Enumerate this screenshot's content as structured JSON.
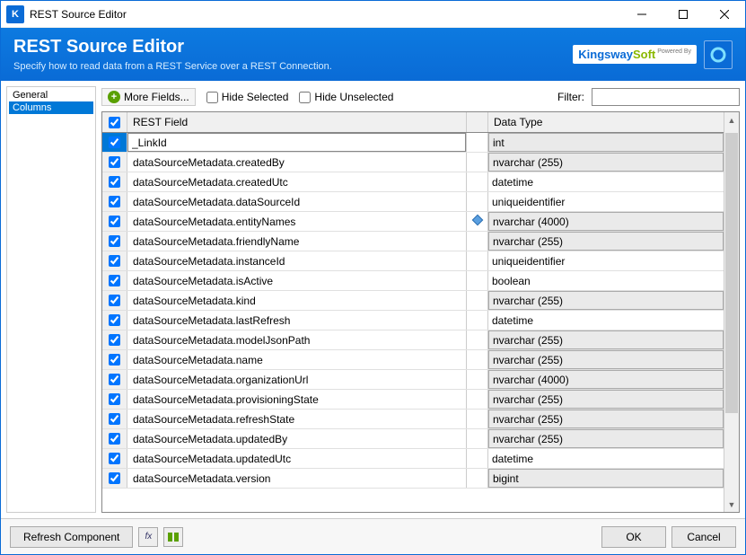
{
  "window": {
    "title": "REST Source Editor"
  },
  "header": {
    "title": "REST Source Editor",
    "subtitle": "Specify how to read data from a REST Service over a REST Connection.",
    "powered_by": "Powered By",
    "logo1": "Kingsway",
    "logo2": "Soft"
  },
  "sidebar": {
    "items": [
      "General",
      "Columns"
    ],
    "selected_index": 1
  },
  "toolbar": {
    "more_fields": "More Fields...",
    "hide_selected": "Hide Selected",
    "hide_unselected": "Hide Unselected",
    "filter_label": "Filter:",
    "filter_value": ""
  },
  "grid": {
    "headers": {
      "field": "REST Field",
      "type": "Data Type"
    },
    "rows": [
      {
        "checked": true,
        "field": "_LinkId",
        "type": "int",
        "selected": true,
        "has_icon": false,
        "dd": true
      },
      {
        "checked": true,
        "field": "dataSourceMetadata.createdBy",
        "type": "nvarchar (255)",
        "selected": false,
        "has_icon": false,
        "dd": true
      },
      {
        "checked": true,
        "field": "dataSourceMetadata.createdUtc",
        "type": "datetime",
        "selected": false,
        "has_icon": false,
        "dd": false
      },
      {
        "checked": true,
        "field": "dataSourceMetadata.dataSourceId",
        "type": "uniqueidentifier",
        "selected": false,
        "has_icon": false,
        "dd": false
      },
      {
        "checked": true,
        "field": "dataSourceMetadata.entityNames",
        "type": "nvarchar (4000)",
        "selected": false,
        "has_icon": true,
        "dd": true
      },
      {
        "checked": true,
        "field": "dataSourceMetadata.friendlyName",
        "type": "nvarchar (255)",
        "selected": false,
        "has_icon": false,
        "dd": true
      },
      {
        "checked": true,
        "field": "dataSourceMetadata.instanceId",
        "type": "uniqueidentifier",
        "selected": false,
        "has_icon": false,
        "dd": false
      },
      {
        "checked": true,
        "field": "dataSourceMetadata.isActive",
        "type": "boolean",
        "selected": false,
        "has_icon": false,
        "dd": false
      },
      {
        "checked": true,
        "field": "dataSourceMetadata.kind",
        "type": "nvarchar (255)",
        "selected": false,
        "has_icon": false,
        "dd": true
      },
      {
        "checked": true,
        "field": "dataSourceMetadata.lastRefresh",
        "type": "datetime",
        "selected": false,
        "has_icon": false,
        "dd": false
      },
      {
        "checked": true,
        "field": "dataSourceMetadata.modelJsonPath",
        "type": "nvarchar (255)",
        "selected": false,
        "has_icon": false,
        "dd": true
      },
      {
        "checked": true,
        "field": "dataSourceMetadata.name",
        "type": "nvarchar (255)",
        "selected": false,
        "has_icon": false,
        "dd": true
      },
      {
        "checked": true,
        "field": "dataSourceMetadata.organizationUrl",
        "type": "nvarchar (4000)",
        "selected": false,
        "has_icon": false,
        "dd": true
      },
      {
        "checked": true,
        "field": "dataSourceMetadata.provisioningState",
        "type": "nvarchar (255)",
        "selected": false,
        "has_icon": false,
        "dd": true
      },
      {
        "checked": true,
        "field": "dataSourceMetadata.refreshState",
        "type": "nvarchar (255)",
        "selected": false,
        "has_icon": false,
        "dd": true
      },
      {
        "checked": true,
        "field": "dataSourceMetadata.updatedBy",
        "type": "nvarchar (255)",
        "selected": false,
        "has_icon": false,
        "dd": true
      },
      {
        "checked": true,
        "field": "dataSourceMetadata.updatedUtc",
        "type": "datetime",
        "selected": false,
        "has_icon": false,
        "dd": false
      },
      {
        "checked": true,
        "field": "dataSourceMetadata.version",
        "type": "bigint",
        "selected": false,
        "has_icon": false,
        "dd": true
      }
    ]
  },
  "footer": {
    "refresh": "Refresh Component",
    "ok": "OK",
    "cancel": "Cancel"
  }
}
